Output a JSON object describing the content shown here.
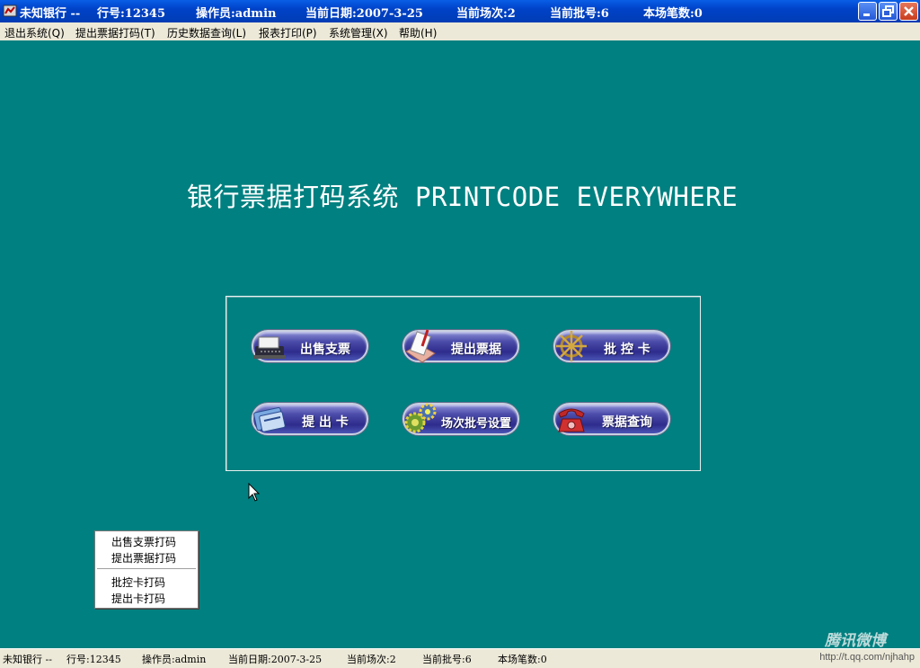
{
  "titlebar": {
    "app_name": "未知银行 --",
    "branch": "行号:12345",
    "operator": "操作员:admin",
    "date": "当前日期:2007-3-25",
    "session": "当前场次:2",
    "batch": "当前批号:6",
    "count": "本场笔数:0",
    "buttons": [
      "minimize-icon",
      "restore-icon",
      "close-icon"
    ]
  },
  "menu": [
    "退出系统(Q)",
    "提出票据打码(T)",
    "历史数据查询(L)",
    "报表打印(P)",
    "系统管理(X)",
    "帮助(H)"
  ],
  "main": {
    "title_cn": "银行票据打码系统",
    "title_en": "PRINTCODE EVERYWHERE"
  },
  "buttons": [
    {
      "label": "出售支票",
      "icon": "typewriter-icon"
    },
    {
      "label": "提出票据",
      "icon": "document-pen-icon"
    },
    {
      "label": "批 控 卡",
      "icon": "ship-wheel-icon"
    },
    {
      "label": "提 出 卡",
      "icon": "card-icon"
    },
    {
      "label": "场次批号设置",
      "icon": "gears-icon"
    },
    {
      "label": "票据查询",
      "icon": "telephone-icon"
    }
  ],
  "context_menu": {
    "group1": [
      "出售支票打码",
      "提出票据打码"
    ],
    "group2": [
      "批控卡打码",
      "提出卡打码"
    ]
  },
  "statusbar": {
    "app_name": "未知银行 --",
    "branch": "行号:12345",
    "operator": "操作员:admin",
    "date": "当前日期:2007-3-25",
    "session": "当前场次:2",
    "batch": "当前批号:6",
    "count": "本场笔数:0",
    "url": "http://t.qq.com/njhahp"
  },
  "watermark": "腾讯微博",
  "colors": {
    "desktop": "#008080",
    "titlebar": "#0042c8",
    "menubar": "#ece9d8",
    "button": "#2e2c8c"
  }
}
